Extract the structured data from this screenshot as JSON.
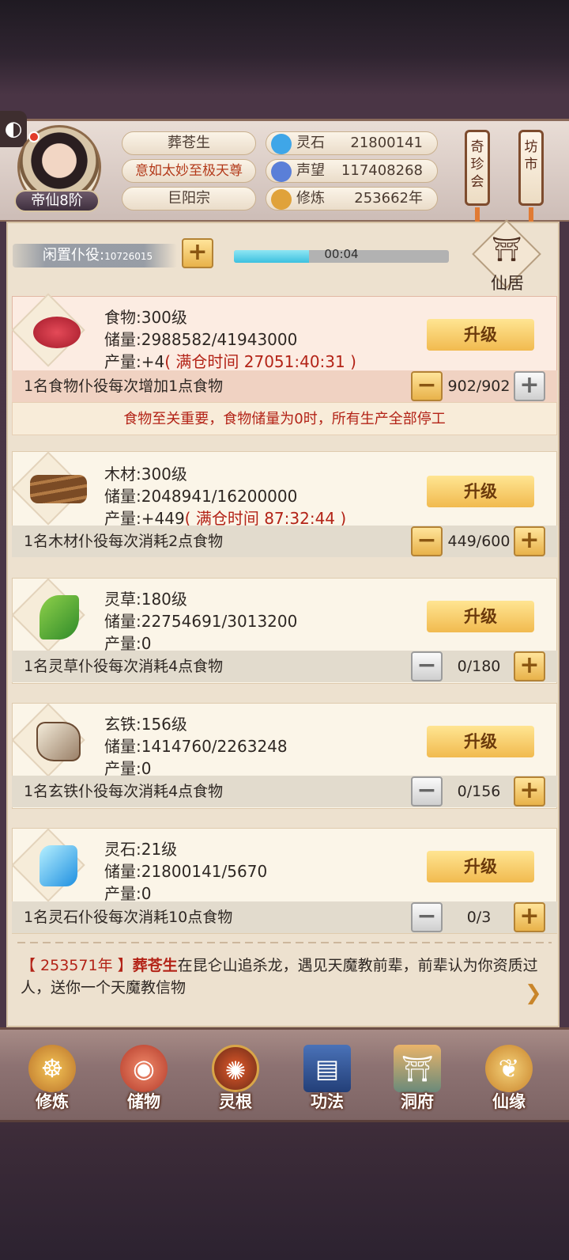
{
  "header": {
    "player_name": "葬苍生",
    "title": "意如太妙至极天尊",
    "sect": "巨阳宗",
    "rank": "帝仙8阶",
    "resources": [
      {
        "label": "灵石",
        "value": "21800141",
        "icon": "spirit-stone-icon",
        "color": "#3fa6e8"
      },
      {
        "label": "声望",
        "value": "117408268",
        "icon": "prestige-crystal-icon",
        "color": "#5a7fd8"
      },
      {
        "label": "修炼",
        "value": "253662年",
        "icon": "meditating-figure-icon",
        "color": "#e0a23a"
      }
    ],
    "lanterns": [
      {
        "label": "奇珍会"
      },
      {
        "label": "坊市"
      }
    ]
  },
  "idle": {
    "label": "闲置仆役",
    "separator": ":",
    "count": "10726015",
    "progress_text": "00:04",
    "progress_fraction": 0.35
  },
  "xianju": {
    "label": "仙居",
    "glyph": "⛩"
  },
  "resources": [
    {
      "name": "食物:300级",
      "storage": "储量:2988582/41943000",
      "output": "产量:+4",
      "full_time": "( 满仓时间 27051:40:31 )",
      "upgrade": "升级",
      "work": "1名食物仆役每次增加1点食物",
      "count": "902/902",
      "icon": "meat-icon"
    },
    {
      "name": "木材:300级",
      "storage": "储量:2048941/16200000",
      "output": "产量:+449",
      "full_time": "( 满仓时间 87:32:44 )",
      "upgrade": "升级",
      "work": "1名木材仆役每次消耗2点食物",
      "count": "449/600",
      "icon": "wood-logs-icon"
    },
    {
      "name": "灵草:180级",
      "storage": "储量:22754691/3013200",
      "output": "产量:0",
      "full_time": "",
      "upgrade": "升级",
      "work": "1名灵草仆役每次消耗4点食物",
      "count": "0/180",
      "icon": "herb-icon"
    },
    {
      "name": "玄铁:156级",
      "storage": "储量:1414760/2263248",
      "output": "产量:0",
      "full_time": "",
      "upgrade": "升级",
      "work": "1名玄铁仆役每次消耗4点食物",
      "count": "0/156",
      "icon": "iron-ore-icon"
    },
    {
      "name": "灵石:21级",
      "storage": "储量:21800141/5670",
      "output": "产量:0",
      "full_time": "",
      "upgrade": "升级",
      "work": "1名灵石仆役每次消耗10点食物",
      "count": "0/3",
      "icon": "blue-crystal-icon"
    }
  ],
  "warning": "食物至关重要，食物储量为0时，所有生产全部停工",
  "log": {
    "year": "【 253571年 】",
    "name": "葬苍生",
    "text": "在昆仑山追杀龙，遇见天魔教前辈，前辈认为你资质过人，送你一个天魔教信物"
  },
  "nav": [
    {
      "label": "修炼",
      "icon": "cultivate-icon"
    },
    {
      "label": "储物",
      "icon": "storage-bag-icon"
    },
    {
      "label": "灵根",
      "icon": "spirit-root-icon"
    },
    {
      "label": "功法",
      "icon": "technique-book-icon"
    },
    {
      "label": "洞府",
      "icon": "cave-mansion-icon"
    },
    {
      "label": "仙缘",
      "icon": "fortune-gourd-icon"
    }
  ],
  "buttons": {
    "plus": "+",
    "minus": "−"
  }
}
